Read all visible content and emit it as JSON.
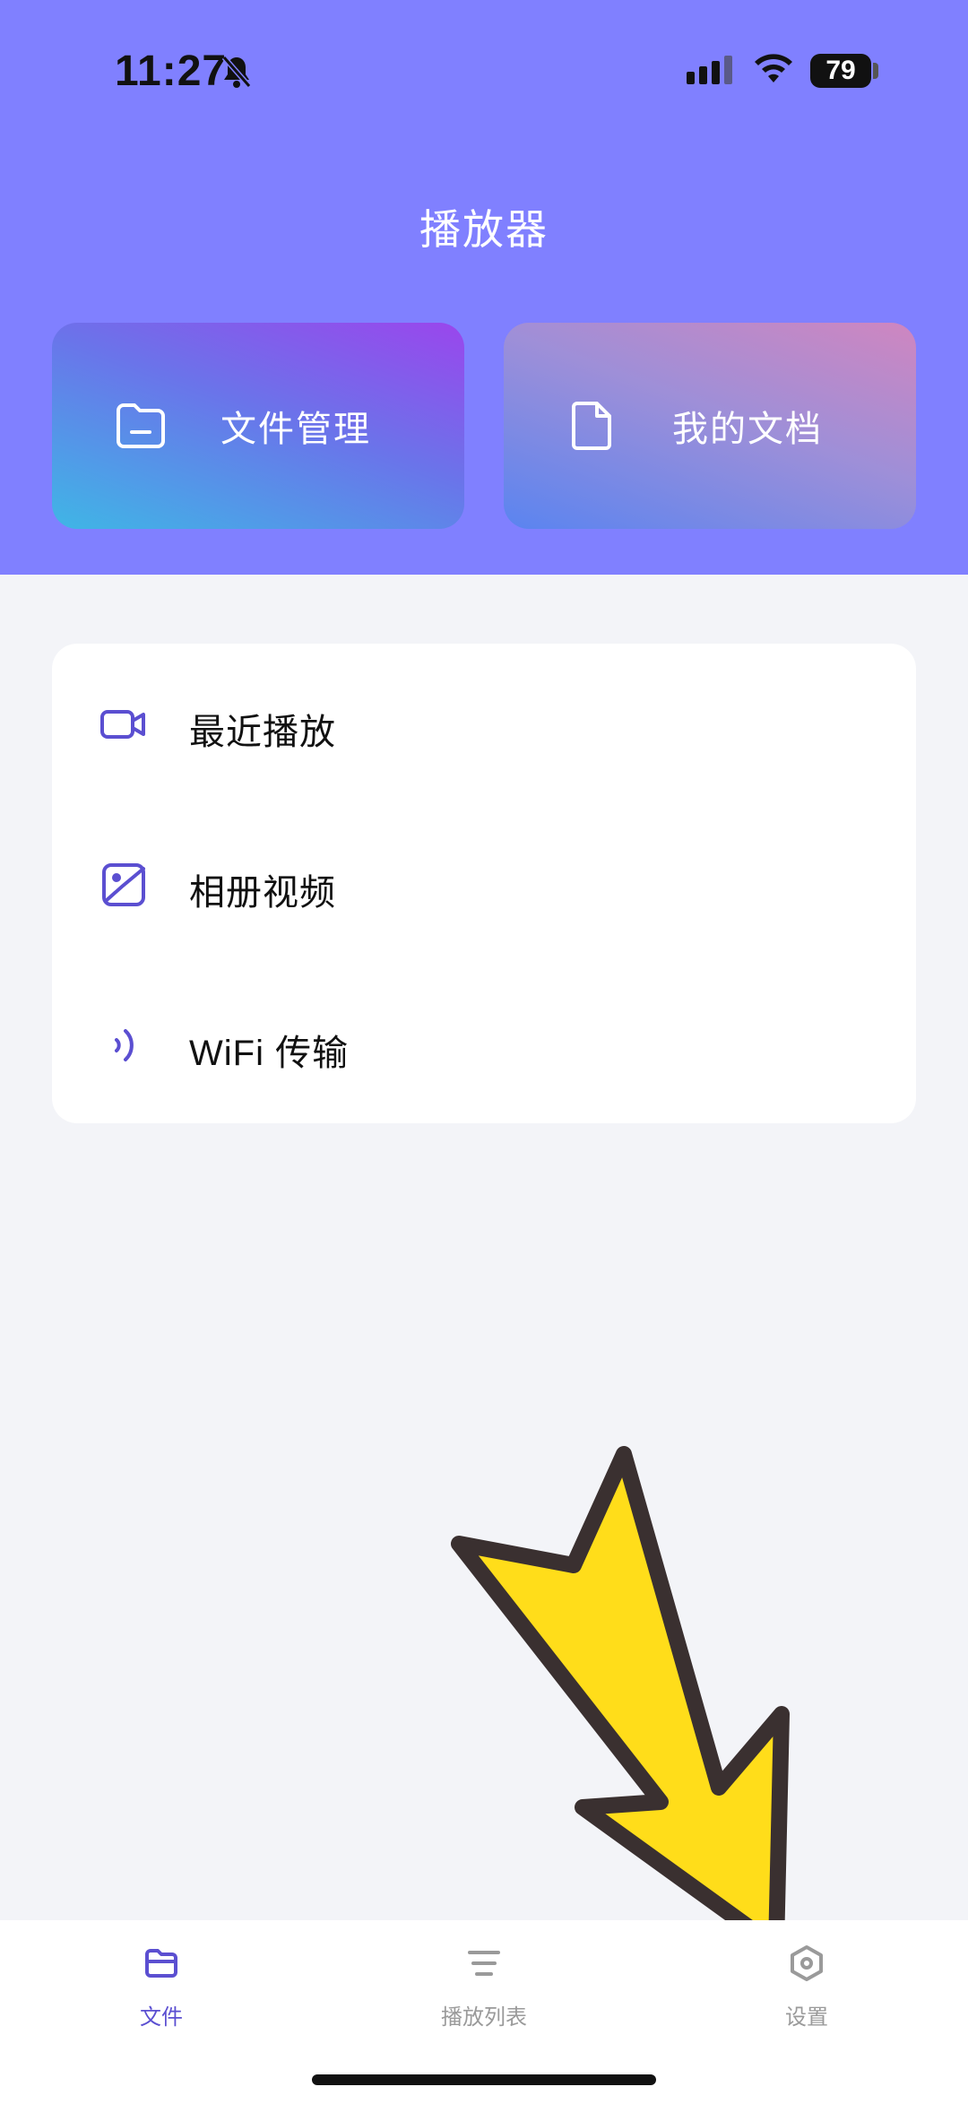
{
  "status_bar": {
    "time": "11:27",
    "battery": "79"
  },
  "header": {
    "title": "播放器"
  },
  "quick_actions": [
    {
      "label": "文件管理",
      "icon": "folder-icon"
    },
    {
      "label": "我的文档",
      "icon": "document-icon"
    }
  ],
  "menu": [
    {
      "label": "最近播放",
      "icon": "video-camera-icon"
    },
    {
      "label": "相册视频",
      "icon": "photo-gallery-icon"
    },
    {
      "label": "WiFi 传输",
      "icon": "wifi-signal-icon"
    }
  ],
  "tabs": [
    {
      "label": "文件",
      "icon": "folder-icon",
      "active": true
    },
    {
      "label": "播放列表",
      "icon": "list-icon",
      "active": false
    },
    {
      "label": "设置",
      "icon": "hexagon-settings-icon",
      "active": false
    }
  ],
  "colors": {
    "header": "#8080ff",
    "accent": "#5b4fd1",
    "arrow": "#ffdd1a"
  }
}
